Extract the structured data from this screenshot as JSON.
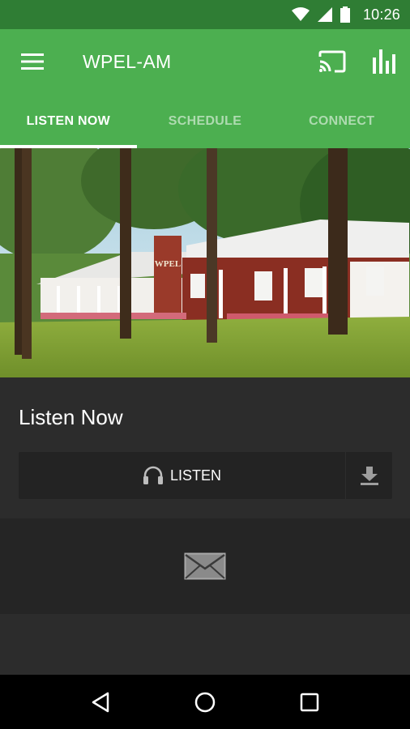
{
  "status_bar": {
    "time": "10:26"
  },
  "app_bar": {
    "title": "WPEL-AM",
    "menu_icon": "menu-icon",
    "cast_icon": "cast-icon",
    "equalizer_icon": "equalizer-icon"
  },
  "tabs": [
    {
      "label": "LISTEN NOW",
      "active": true
    },
    {
      "label": "SCHEDULE",
      "active": false
    },
    {
      "label": "CONNECT",
      "active": false
    }
  ],
  "hero": {
    "sign_text": "WPEL",
    "description": "station building photo"
  },
  "listen_section": {
    "title": "Listen Now",
    "listen_label": "LISTEN",
    "listen_icon": "headphones-icon",
    "download_icon": "download-icon"
  },
  "contact": {
    "icon": "mail-icon"
  },
  "nav": {
    "back_icon": "back-icon",
    "home_icon": "home-icon",
    "recents_icon": "recents-icon"
  },
  "colors": {
    "primary": "#4caf50",
    "primary_dark": "#2f7d34",
    "content_bg": "#2c2c2c"
  }
}
